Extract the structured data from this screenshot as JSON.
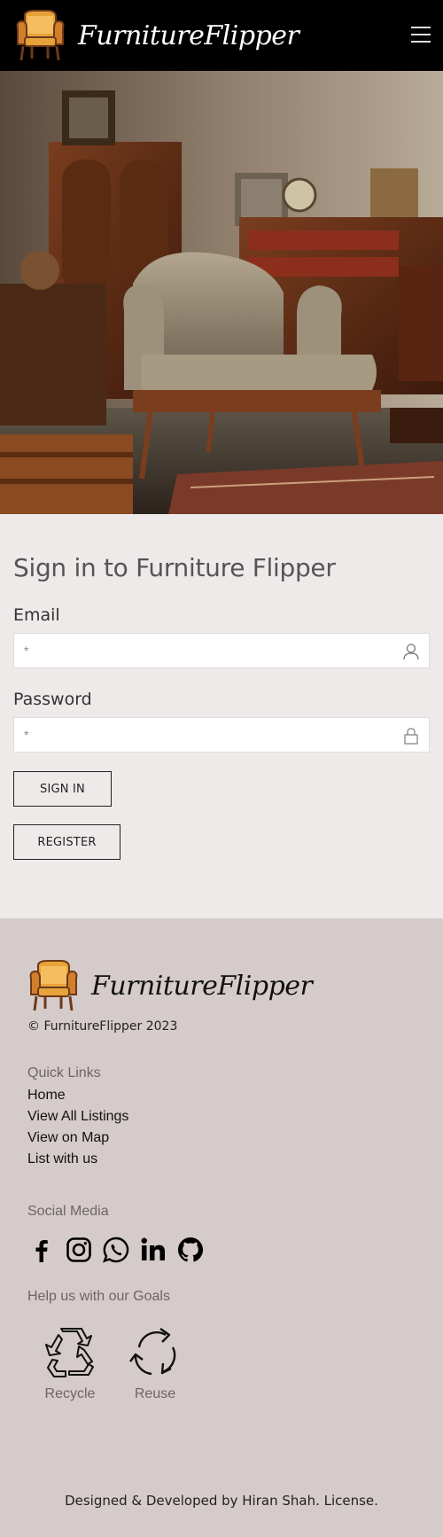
{
  "header": {
    "brand": "FurnitureFlipper",
    "menu_icon": "hamburger-menu-icon",
    "logo_icon": "armchair-logo-icon"
  },
  "hero": {
    "image": "vintage-armchair-room-photo"
  },
  "signin": {
    "title": "Sign in to Furniture Flipper",
    "email_label": "Email",
    "email_placeholder": "*",
    "email_icon": "user-icon",
    "password_label": "Password",
    "password_placeholder": "*",
    "password_icon": "lock-icon",
    "signin_button": "SIGN IN",
    "register_button": "REGISTER"
  },
  "footer": {
    "brand": "FurnitureFlipper",
    "copyright": "© FurnitureFlipper 2023",
    "quick_links_heading": "Quick Links",
    "quick_links": [
      "Home",
      "View All Listings",
      "View on Map",
      "List with us"
    ],
    "social_heading": "Social Media",
    "social_icons": [
      "facebook-icon",
      "instagram-icon",
      "whatsapp-icon",
      "linkedin-icon",
      "github-icon"
    ],
    "goals_heading": "Help us with our Goals",
    "goals": [
      "Recycle",
      "Reuse"
    ],
    "credits": "Designed & Developed by Hiran Shah. License."
  },
  "colors": {
    "header_bg": "#000000",
    "signin_bg": "#eeeae9",
    "footer_bg": "#d5cbca",
    "logo_gold": "#e8a23a",
    "logo_brown": "#6b3a1a"
  }
}
